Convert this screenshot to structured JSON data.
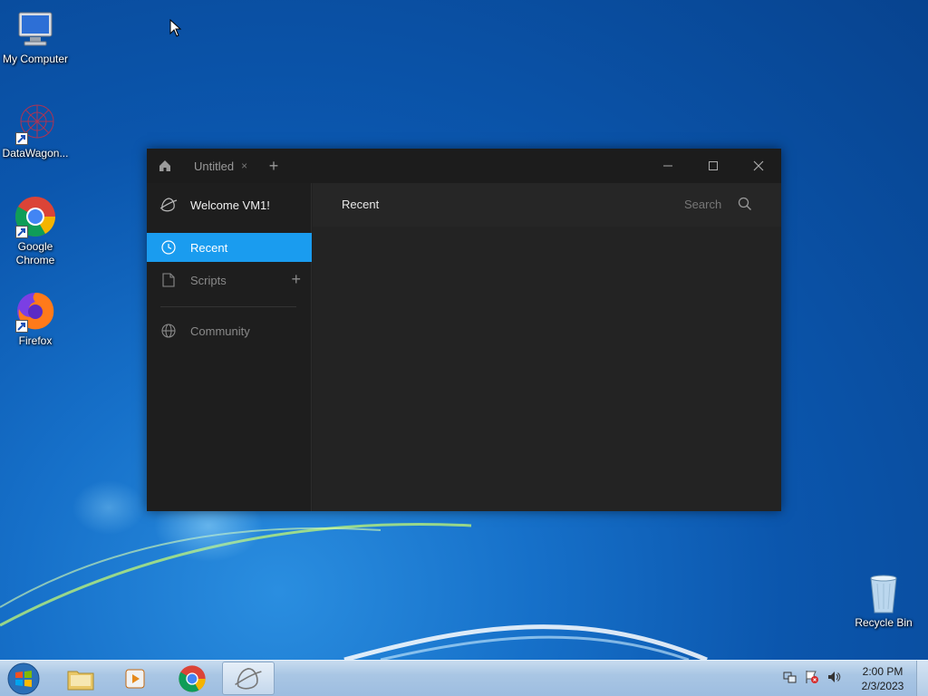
{
  "desktop": {
    "icons": [
      {
        "label": "My Computer",
        "icon": "computer-icon"
      },
      {
        "label": "DataWagon...",
        "icon": "datawagon-icon"
      },
      {
        "label": "Google Chrome",
        "icon": "chrome-icon"
      },
      {
        "label": "Firefox",
        "icon": "firefox-icon"
      },
      {
        "label": "Recycle Bin",
        "icon": "recycle-bin-icon"
      }
    ]
  },
  "window": {
    "tab": {
      "label": "Untitled",
      "close": "×"
    },
    "new_tab": "+",
    "controls": {
      "minimize": "minimize-icon",
      "maximize": "maximize-icon",
      "close": "close-icon"
    },
    "sidebar": {
      "welcome": "Welcome VM1!",
      "items": [
        {
          "label": "Recent",
          "icon": "clock-icon",
          "active": true
        },
        {
          "label": "Scripts",
          "icon": "file-icon",
          "action": "+"
        },
        {
          "label": "Community",
          "icon": "globe-icon"
        }
      ]
    },
    "main": {
      "title": "Recent",
      "search_placeholder": "Search"
    }
  },
  "taskbar": {
    "clock": {
      "time": "2:00 PM",
      "date": "2/3/2023"
    },
    "colors": {
      "accent": "#1a9cef"
    }
  }
}
